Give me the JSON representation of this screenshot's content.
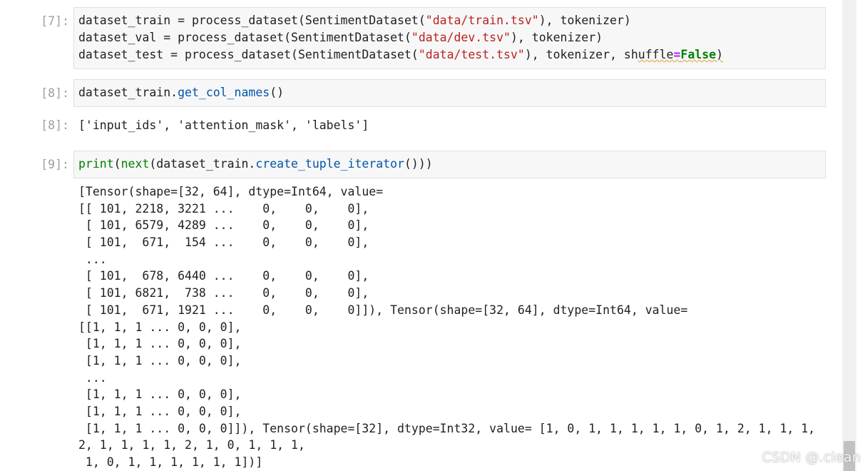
{
  "cells": [
    {
      "prompt": "[7]:",
      "lines": [
        {
          "pre": "dataset_train = process_dataset(SentimentDataset(",
          "str": "\"data/train.tsv\"",
          "post": "), tokenizer)"
        },
        {
          "pre": "dataset_val = process_dataset(SentimentDataset(",
          "str": "\"data/dev.tsv\"",
          "post": "), tokenizer)"
        },
        {
          "pre": "dataset_test = process_dataset(SentimentDataset(",
          "str": "\"data/test.tsv\"",
          "post": "), tokenizer, sh",
          "squiggle": "uffle",
          "op": "=",
          "kw": "False",
          "tail": ")"
        }
      ]
    },
    {
      "prompt": "[8]:",
      "code_pre": "dataset_train.",
      "code_fn": "get_col_names",
      "code_post": "()"
    },
    {
      "prompt_out": "[8]:",
      "output": "['input_ids', 'attention_mask', 'labels']"
    },
    {
      "prompt": "[9]:",
      "code_builtin1": "print",
      "code_p1": "(",
      "code_builtin2": "next",
      "code_p2": "(dataset_train.",
      "code_fn": "create_tuple_iterator",
      "code_post": "()))"
    }
  ],
  "stream_output": [
    "[Tensor(shape=[32, 64], dtype=Int64, value=",
    "[[ 101, 2218, 3221 ...    0,    0,    0],",
    " [ 101, 6579, 4289 ...    0,    0,    0],",
    " [ 101,  671,  154 ...    0,    0,    0],",
    " ...",
    " [ 101,  678, 6440 ...    0,    0,    0],",
    " [ 101, 6821,  738 ...    0,    0,    0],",
    " [ 101,  671, 1921 ...    0,    0,    0]]), Tensor(shape=[32, 64], dtype=Int64, value=",
    "[[1, 1, 1 ... 0, 0, 0],",
    " [1, 1, 1 ... 0, 0, 0],",
    " [1, 1, 1 ... 0, 0, 0],",
    " ...",
    " [1, 1, 1 ... 0, 0, 0],",
    " [1, 1, 1 ... 0, 0, 0],",
    " [1, 1, 1 ... 0, 0, 0]]), Tensor(shape=[32], dtype=Int32, value= [1, 0, 1, 1, 1, 1, 1, 0, 1, 2, 1, 1, 1,",
    "2, 1, 1, 1, 1, 2, 1, 0, 1, 1, 1,",
    " 1, 0, 1, 1, 1, 1, 1, 1])]"
  ],
  "watermark": "CSDN @.clean"
}
